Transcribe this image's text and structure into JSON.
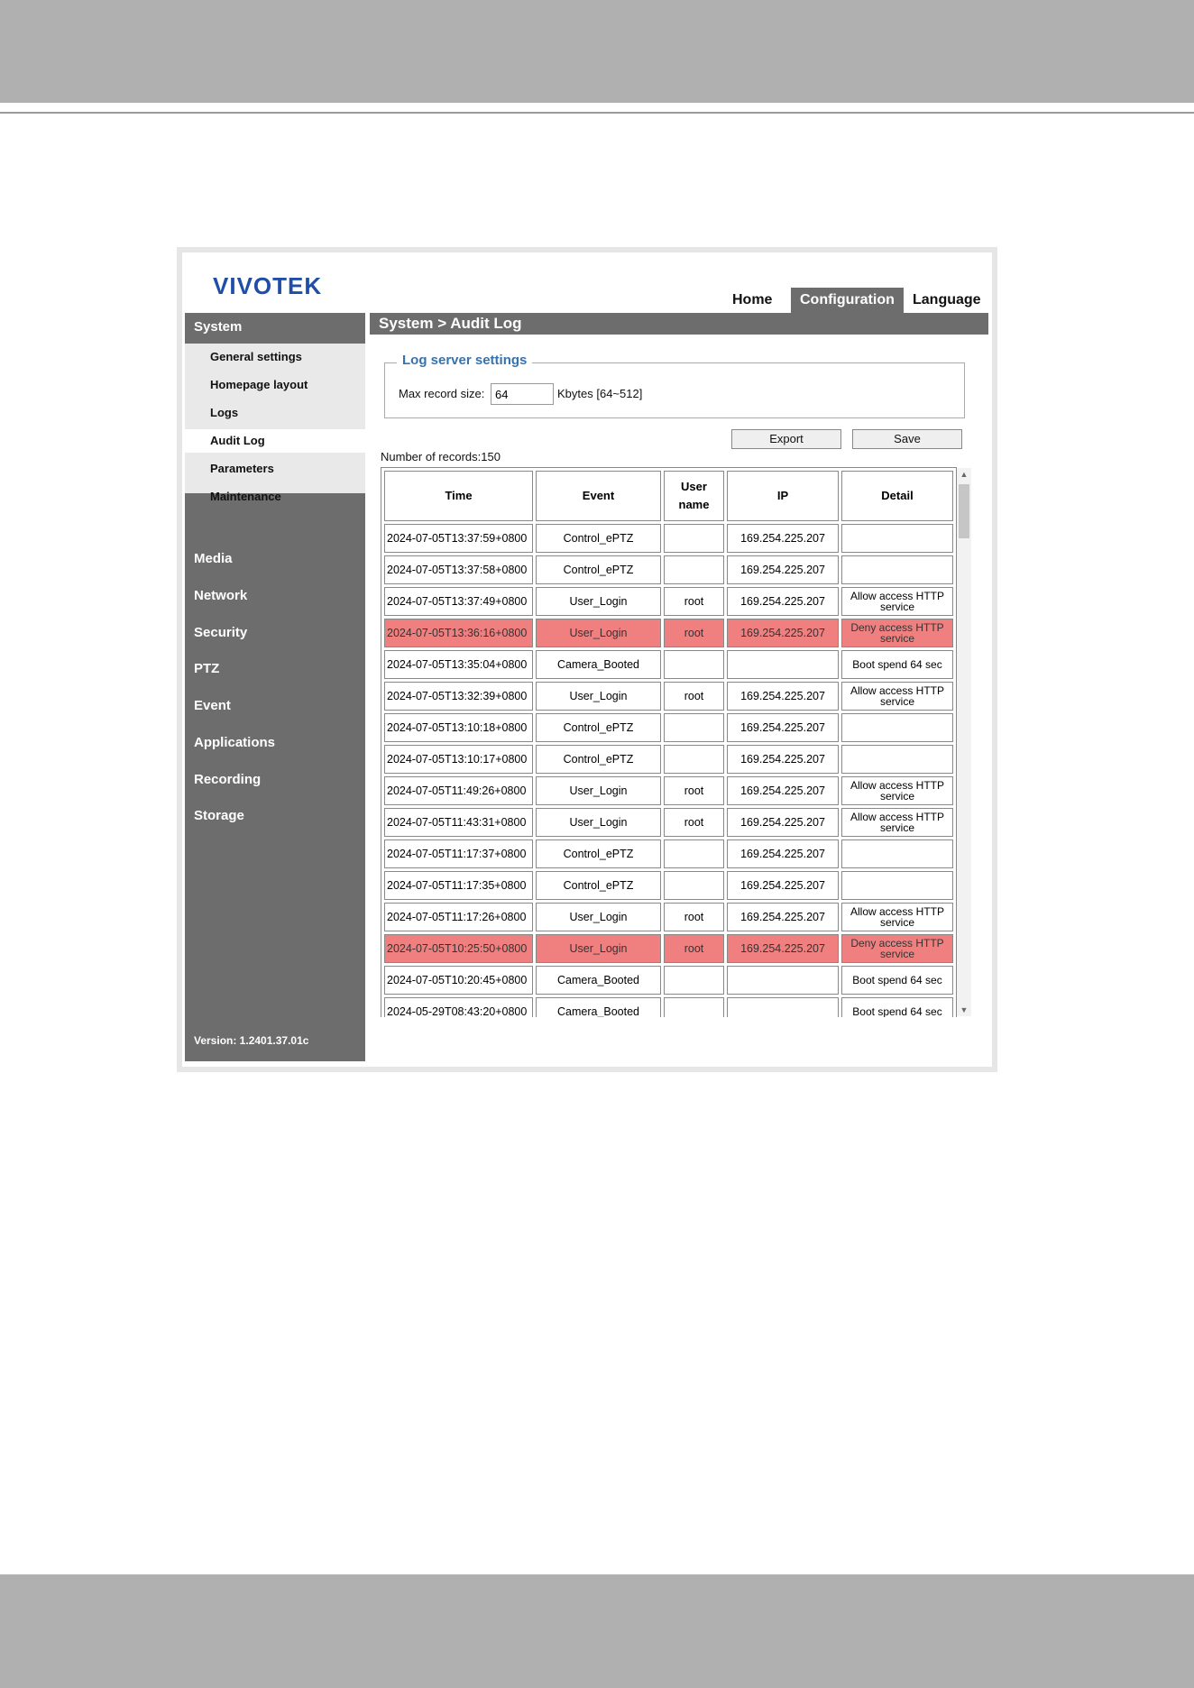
{
  "brand": "VIVOTEK",
  "topnav": {
    "home": "Home",
    "configuration": "Configuration",
    "language": "Language"
  },
  "page_title": "System  > Audit Log",
  "sidebar": {
    "system": "System",
    "system_items": [
      "General settings",
      "Homepage layout",
      "Logs",
      "Audit Log",
      "Parameters",
      "Maintenance"
    ],
    "main_items": [
      "Media",
      "Network",
      "Security",
      "PTZ",
      "Event",
      "Applications",
      "Recording",
      "Storage"
    ],
    "version": "Version: 1.2401.37.01c"
  },
  "log_server": {
    "legend": "Log server settings",
    "max_label": "Max record size:",
    "max_value": "64",
    "unit": "Kbytes [64~512]"
  },
  "buttons": {
    "export": "Export",
    "save": "Save"
  },
  "records_label": "Number of records:150",
  "table": {
    "headers": {
      "time": "Time",
      "event": "Event",
      "user": "User name",
      "ip": "IP",
      "detail": "Detail"
    },
    "rows": [
      {
        "time": "2024-07-05T13:37:59+0800",
        "event": "Control_ePTZ",
        "user": "",
        "ip": "169.254.225.207",
        "detail": "",
        "deny": false
      },
      {
        "time": "2024-07-05T13:37:58+0800",
        "event": "Control_ePTZ",
        "user": "",
        "ip": "169.254.225.207",
        "detail": "",
        "deny": false
      },
      {
        "time": "2024-07-05T13:37:49+0800",
        "event": "User_Login",
        "user": "root",
        "ip": "169.254.225.207",
        "detail": "Allow access HTTP service",
        "deny": false
      },
      {
        "time": "2024-07-05T13:36:16+0800",
        "event": "User_Login",
        "user": "root",
        "ip": "169.254.225.207",
        "detail": "Deny access HTTP service",
        "deny": true
      },
      {
        "time": "2024-07-05T13:35:04+0800",
        "event": "Camera_Booted",
        "user": "",
        "ip": "",
        "detail": "Boot spend 64 sec",
        "deny": false
      },
      {
        "time": "2024-07-05T13:32:39+0800",
        "event": "User_Login",
        "user": "root",
        "ip": "169.254.225.207",
        "detail": "Allow access HTTP service",
        "deny": false
      },
      {
        "time": "2024-07-05T13:10:18+0800",
        "event": "Control_ePTZ",
        "user": "",
        "ip": "169.254.225.207",
        "detail": "",
        "deny": false
      },
      {
        "time": "2024-07-05T13:10:17+0800",
        "event": "Control_ePTZ",
        "user": "",
        "ip": "169.254.225.207",
        "detail": "",
        "deny": false
      },
      {
        "time": "2024-07-05T11:49:26+0800",
        "event": "User_Login",
        "user": "root",
        "ip": "169.254.225.207",
        "detail": "Allow access HTTP service",
        "deny": false
      },
      {
        "time": "2024-07-05T11:43:31+0800",
        "event": "User_Login",
        "user": "root",
        "ip": "169.254.225.207",
        "detail": "Allow access HTTP service",
        "deny": false
      },
      {
        "time": "2024-07-05T11:17:37+0800",
        "event": "Control_ePTZ",
        "user": "",
        "ip": "169.254.225.207",
        "detail": "",
        "deny": false
      },
      {
        "time": "2024-07-05T11:17:35+0800",
        "event": "Control_ePTZ",
        "user": "",
        "ip": "169.254.225.207",
        "detail": "",
        "deny": false
      },
      {
        "time": "2024-07-05T11:17:26+0800",
        "event": "User_Login",
        "user": "root",
        "ip": "169.254.225.207",
        "detail": "Allow access HTTP service",
        "deny": false
      },
      {
        "time": "2024-07-05T10:25:50+0800",
        "event": "User_Login",
        "user": "root",
        "ip": "169.254.225.207",
        "detail": "Deny access HTTP service",
        "deny": true
      },
      {
        "time": "2024-07-05T10:20:45+0800",
        "event": "Camera_Booted",
        "user": "",
        "ip": "",
        "detail": "Boot spend 64 sec",
        "deny": false
      },
      {
        "time": "2024-05-29T08:43:20+0800",
        "event": "Camera_Booted",
        "user": "",
        "ip": "",
        "detail": "Boot spend 64 sec",
        "deny": false
      }
    ]
  },
  "colors": {
    "deny_row": "#f08080",
    "nav_gray": "#6d6d6d",
    "accent_blue": "#3573b0",
    "brand_blue": "#1f4ea8"
  }
}
